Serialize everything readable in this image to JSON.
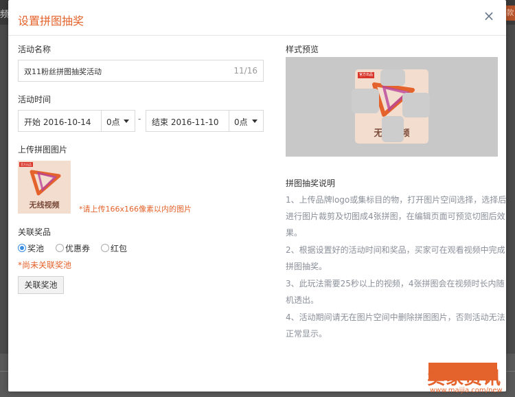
{
  "background": {
    "left_text": "频",
    "right_tab": "款"
  },
  "modal": {
    "title": "设置拼图抽奖",
    "close_glyph": "×",
    "activity_name": {
      "label": "活动名称",
      "value": "双11粉丝拼图抽奖活动",
      "counter": "11/16"
    },
    "activity_time": {
      "label": "活动时间",
      "start_text": "开始  2016-10-14",
      "start_hour": "0点",
      "separator": "-",
      "end_text": "结束  2016-11-10",
      "end_hour": "0点"
    },
    "upload": {
      "label": "上传拼图图片",
      "thumb_tag": "官方出品",
      "thumb_text": "无线视频",
      "hint": "*请上传166x166像素以内的图片"
    },
    "prize": {
      "label": "关联奖品",
      "options": [
        {
          "label": "奖池",
          "checked": true
        },
        {
          "label": "优惠券",
          "checked": false
        },
        {
          "label": "红包",
          "checked": false
        }
      ],
      "warning": "*尚未关联奖池",
      "button": "关联奖池"
    },
    "preview": {
      "label": "样式预览",
      "card_tag": "官方出品",
      "card_text": "无线视频"
    },
    "description": {
      "title": "拼图抽奖说明",
      "lines": [
        "1、上传品牌logo或集标目的物，打开图片空间选择，选择后",
        "进行图片裁剪及切图成4张拼图，在编辑页面可预览切图后效",
        "果。",
        "2、根据设置好的活动时间和奖品，买家可在观看视频中完成",
        "拼图抽奖。",
        "3、此玩法需要25秒以上的视频，4张拼图会在视频时长内随",
        "机透出。",
        "4、活动期间请无在图片空间中删除拼图图片，否则活动无法",
        "正常显示。"
      ]
    }
  },
  "watermark": {
    "text": "卖家资讯",
    "url": "www.maijia.com/new"
  },
  "colors": {
    "accent": "#e4622b",
    "radio": "#3c8dde",
    "description": "#8a8f99"
  }
}
